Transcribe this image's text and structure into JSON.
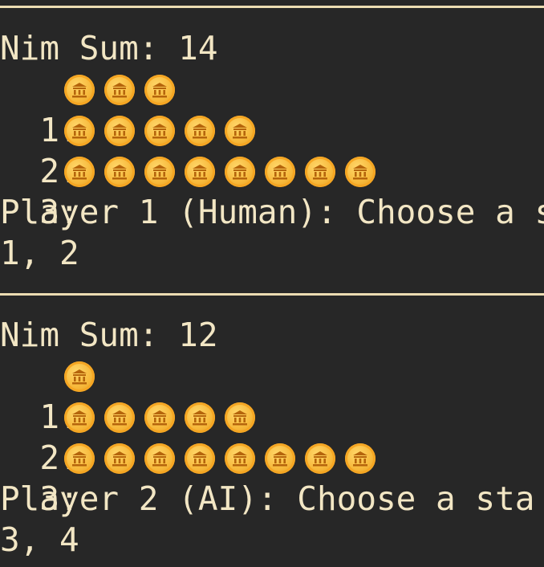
{
  "blocks": [
    {
      "nim_sum_label": "Nim Sum: 14",
      "piles": [
        {
          "label": "1:",
          "count": 3
        },
        {
          "label": "2:",
          "count": 5
        },
        {
          "label": "3:",
          "count": 8
        }
      ],
      "prompt": "Player 1 (Human): Choose a s",
      "input": "1, 2"
    },
    {
      "nim_sum_label": "Nim Sum: 12",
      "piles": [
        {
          "label": "1:",
          "count": 1
        },
        {
          "label": "2:",
          "count": 5
        },
        {
          "label": "3:",
          "count": 8
        }
      ],
      "prompt": "Player 2 (AI): Choose a sta",
      "input": "3, 4"
    }
  ],
  "coin_icon": "coin-icon",
  "colors": {
    "background": "#272727",
    "text": "#f2e6c4",
    "coin": "#f7b93b"
  }
}
